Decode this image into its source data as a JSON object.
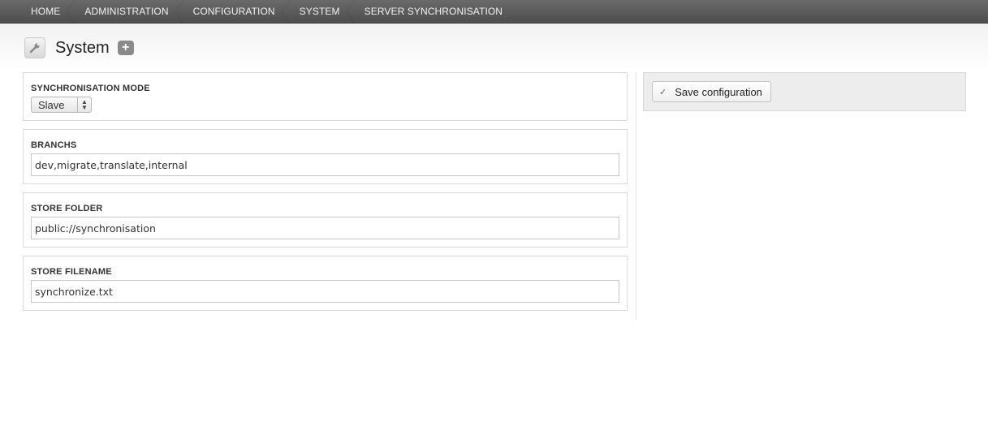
{
  "breadcrumb": [
    "HOME",
    "ADMINISTRATION",
    "CONFIGURATION",
    "SYSTEM",
    "SERVER SYNCHRONISATION"
  ],
  "header": {
    "title": "System",
    "add_label": "+",
    "icon": "wrench-icon"
  },
  "form": {
    "mode": {
      "label": "SYNCHRONISATION MODE",
      "value": "Slave"
    },
    "branchs": {
      "label": "BRANCHS",
      "value": "dev,migrate,translate,internal"
    },
    "store_folder": {
      "label": "STORE FOLDER",
      "value": "public://synchronisation"
    },
    "store_filename": {
      "label": "STORE FILENAME",
      "value": "synchronize.txt"
    }
  },
  "actions": {
    "save_label": "Save configuration",
    "save_icon": "check-icon"
  }
}
